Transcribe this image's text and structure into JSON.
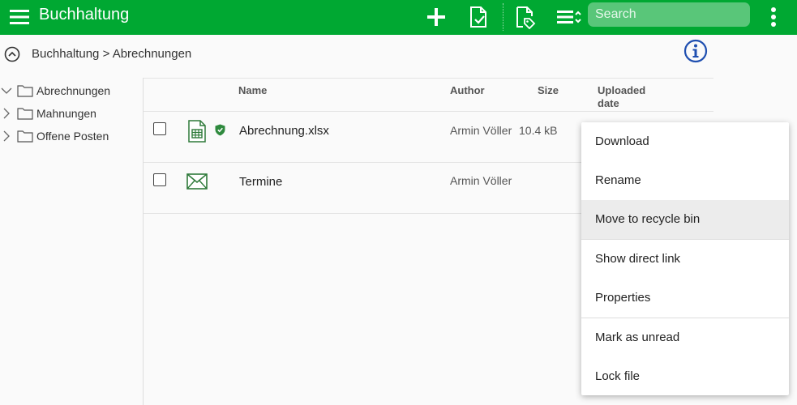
{
  "header": {
    "title": "Buchhaltung",
    "icons": [
      "menu-icon",
      "add-icon",
      "new-document-icon",
      "tag-document-icon",
      "view-options-icon",
      "more-vertical-icon"
    ],
    "search_placeholder": "Search",
    "accent_color": "#00a832"
  },
  "breadcrumb": {
    "root": "Buchhaltung",
    "separator": ">",
    "current": "Abrechnungen"
  },
  "tree": {
    "items": [
      {
        "label": "Abrechnungen",
        "expanded": true
      },
      {
        "label": "Mahnungen",
        "expanded": false
      },
      {
        "label": "Offene Posten",
        "expanded": false
      }
    ]
  },
  "list": {
    "columns": {
      "name": "Name",
      "author": "Author",
      "size": "Size",
      "uploaded_line1": "Uploaded",
      "uploaded_line2": "date"
    },
    "rows": [
      {
        "name": "Abrechnung.xlsx",
        "author": "Armin Völler",
        "size": "10.4 kB",
        "icon": "spreadsheet-icon",
        "badge": "verified-shield-icon"
      },
      {
        "name": "Termine",
        "author": "Armin Völler",
        "size": "",
        "icon": "email-icon"
      }
    ]
  },
  "context_menu": {
    "items": [
      {
        "label": "Download"
      },
      {
        "label": "Rename"
      },
      {
        "label": "Move to recycle bin",
        "highlighted": true
      },
      {
        "label": "Show direct link"
      },
      {
        "label": "Properties"
      },
      {
        "label": "Mark as unread"
      },
      {
        "label": "Lock file"
      }
    ]
  }
}
